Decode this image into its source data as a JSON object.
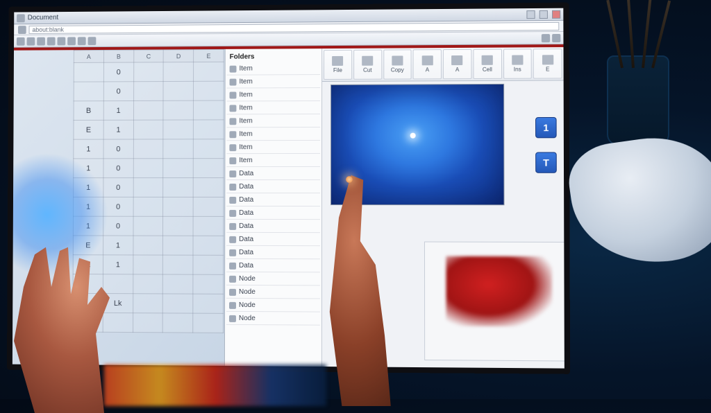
{
  "window": {
    "title": "Document",
    "url_hint": "about:blank"
  },
  "toolbar_icons": [
    "back",
    "fwd",
    "reload",
    "home",
    "search",
    "fav",
    "print",
    "mail",
    "cfg",
    "cfg2"
  ],
  "ribbon": [
    {
      "label": "File"
    },
    {
      "label": "Cut"
    },
    {
      "label": "Copy"
    },
    {
      "label": "A"
    },
    {
      "label": "A"
    },
    {
      "label": "Cell"
    },
    {
      "label": "Ins"
    },
    {
      "label": "E"
    }
  ],
  "grid": {
    "headers": [
      "A",
      "B",
      "C",
      "D",
      "E"
    ],
    "rows": [
      [
        "",
        "0",
        "",
        "",
        ""
      ],
      [
        "",
        "0",
        "",
        "",
        ""
      ],
      [
        "B",
        "1",
        "",
        "",
        ""
      ],
      [
        "E",
        "1",
        "",
        "",
        ""
      ],
      [
        "1",
        "0",
        "",
        "",
        ""
      ],
      [
        "1",
        "0",
        "",
        "",
        ""
      ],
      [
        "1",
        "0",
        "",
        "",
        ""
      ],
      [
        "1",
        "0",
        "",
        "",
        ""
      ],
      [
        "1",
        "0",
        "",
        "",
        ""
      ],
      [
        "E",
        "1",
        "",
        "",
        ""
      ],
      [
        "E",
        "1",
        "",
        "",
        ""
      ],
      [
        "",
        "",
        "",
        "",
        ""
      ],
      [
        "",
        "Lk",
        "",
        "",
        ""
      ],
      [
        "",
        "",
        "",
        "",
        ""
      ]
    ]
  },
  "outline": {
    "header": "Folders",
    "items": [
      "Item",
      "Item",
      "Item",
      "Item",
      "Item",
      "Item",
      "Item",
      "Item",
      "Data",
      "Data",
      "Data",
      "Data",
      "Data",
      "Data",
      "Data",
      "Data",
      "Node",
      "Node",
      "Node",
      "Node"
    ]
  },
  "side_buttons": {
    "a": "1",
    "b": "T"
  }
}
